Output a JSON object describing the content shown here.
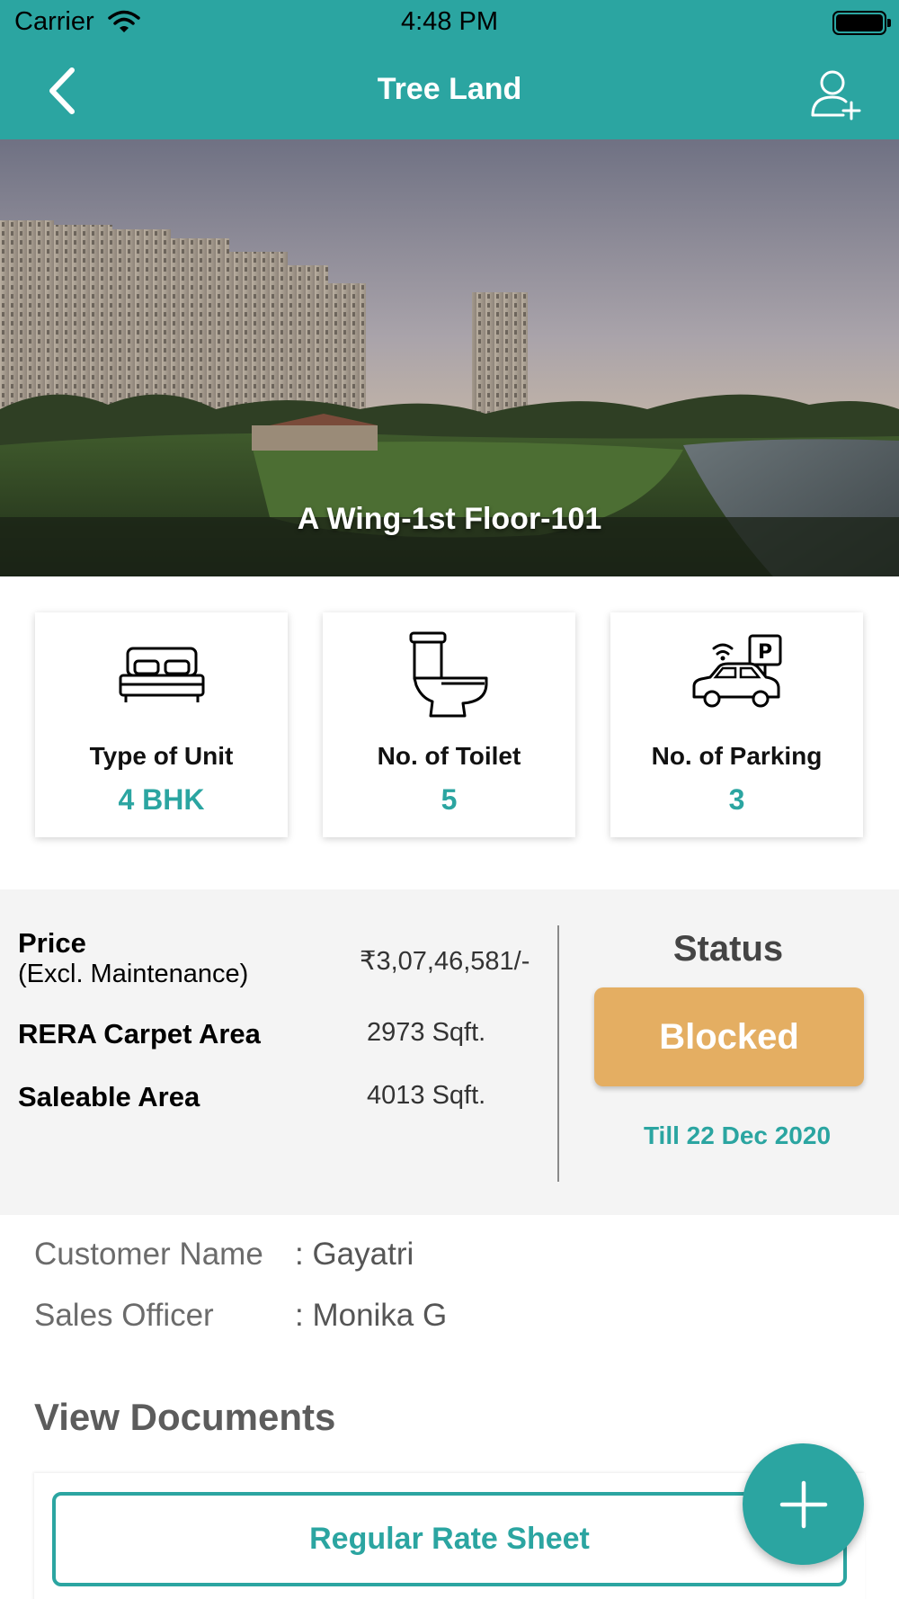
{
  "status_bar": {
    "carrier": "Carrier",
    "time": "4:48 PM"
  },
  "nav": {
    "title": "Tree Land",
    "back_icon": "chevron-left-icon",
    "add_user_icon": "add-user-icon"
  },
  "hero": {
    "caption": "A Wing-1st Floor-101"
  },
  "features": [
    {
      "icon": "bed-icon",
      "label": "Type of Unit",
      "value": "4 BHK"
    },
    {
      "icon": "toilet-icon",
      "label": "No. of Toilet",
      "value": "5"
    },
    {
      "icon": "parking-car-icon",
      "label": "No. of Parking",
      "value": "3"
    }
  ],
  "details": {
    "price_label": "Price",
    "price_sub": "(Excl. Maintenance)",
    "price_value": "₹3,07,46,581/-",
    "rera_label": "RERA Carpet Area",
    "rera_value": "2973 Sqft.",
    "saleable_label": "Saleable Area",
    "saleable_value": "4013 Sqft."
  },
  "status": {
    "title": "Status",
    "badge": "Blocked",
    "till": "Till 22 Dec 2020"
  },
  "customer": {
    "name_label": "Customer Name",
    "name_value": ": Gayatri",
    "officer_label": "Sales Officer",
    "officer_value": ": Monika G"
  },
  "documents": {
    "title": "View Documents",
    "button": "Regular Rate Sheet"
  },
  "colors": {
    "primary": "#2ba5a1",
    "status_blocked": "#e4ae62",
    "panel_bg": "#f4f4f4"
  }
}
